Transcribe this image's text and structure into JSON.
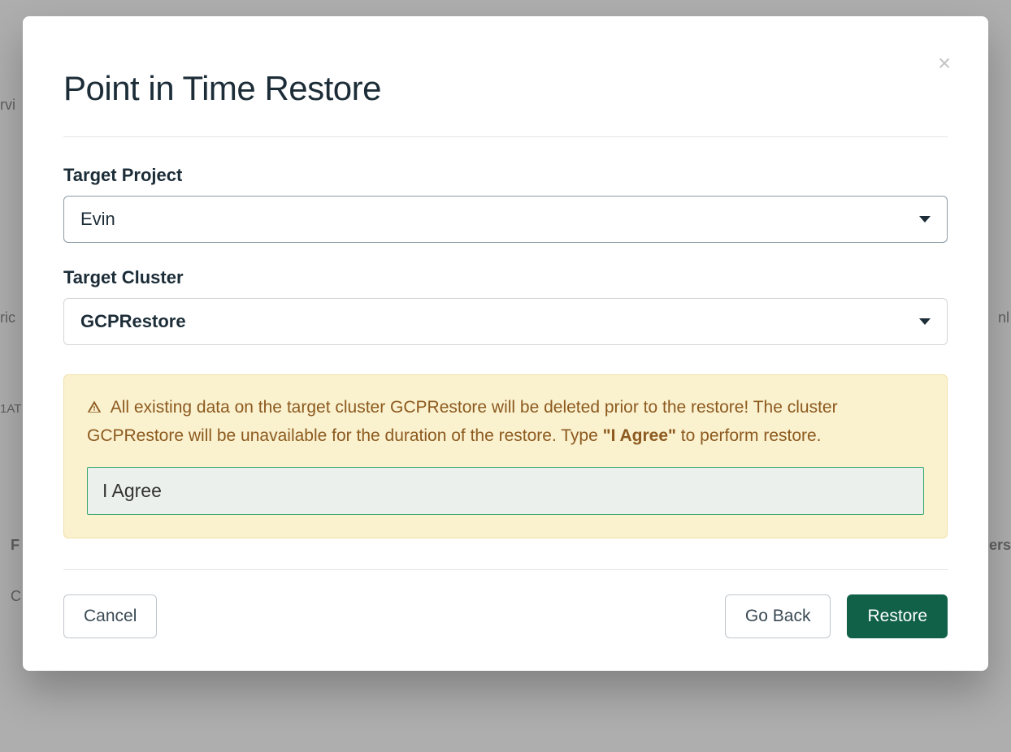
{
  "modal": {
    "title": "Point in Time Restore",
    "close_label": "×",
    "fields": {
      "target_project": {
        "label": "Target Project",
        "value": "Evin"
      },
      "target_cluster": {
        "label": "Target Cluster",
        "value": "GCPRestore"
      }
    },
    "warning": {
      "text_before_bold": "All existing data on the target cluster GCPRestore will be deleted prior to the restore! The cluster GCPRestore will be unavailable for the duration of the restore. Type ",
      "bold": "\"I Agree\"",
      "text_after_bold": " to perform restore.",
      "input_value": "I Agree"
    },
    "buttons": {
      "cancel": "Cancel",
      "go_back": "Go Back",
      "restore": "Restore"
    }
  },
  "background": {
    "left1": "rvi",
    "left2": "ric",
    "left3": "1AT",
    "left4": "F",
    "left5": "C",
    "right1": "nl",
    "right2": "ers"
  }
}
